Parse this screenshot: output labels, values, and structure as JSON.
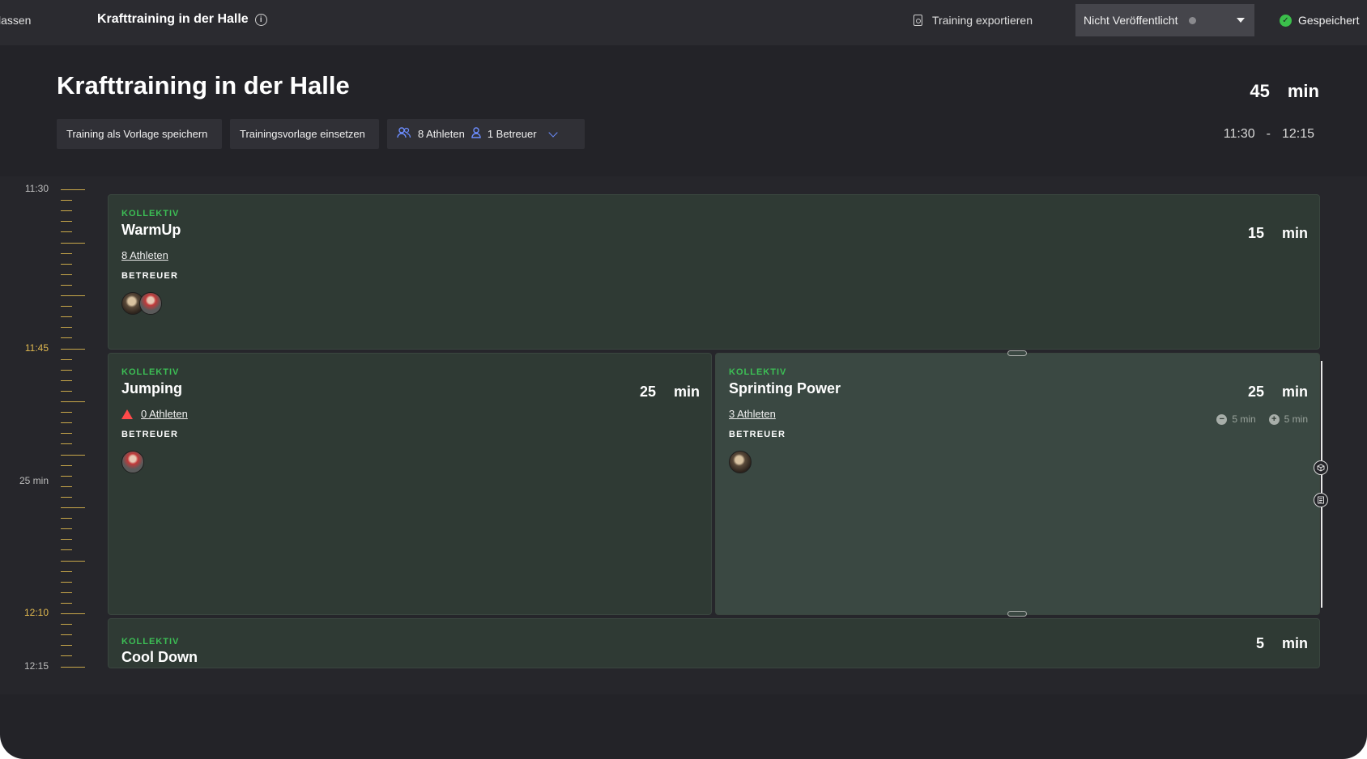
{
  "topbar": {
    "back_label": "lassen",
    "title": "Krafttraining in der Halle",
    "export_label": "Training exportieren",
    "publish_status": "Nicht Veröffentlicht",
    "saved_label": "Gespeichert"
  },
  "header": {
    "title": "Krafttraining in der Halle",
    "save_template_label": "Training als Vorlage speichern",
    "use_template_label": "Trainingsvorlage einsetzen",
    "athletes_label": "8 Athleten",
    "coaches_label": "1 Betreuer",
    "duration_value": "45",
    "duration_unit": "min",
    "start_time": "11:30",
    "time_separator": "-",
    "end_time": "12:15"
  },
  "ruler": {
    "labels": [
      "11:30",
      "11:45",
      "25 min",
      "12:10",
      "12:15"
    ]
  },
  "blocks": [
    {
      "tag": "KOLLEKTIV",
      "name": "WarmUp",
      "athletes": "8 Athleten",
      "coaches_heading": "BETREUER",
      "duration_value": "15",
      "duration_unit": "min"
    },
    {
      "tag": "KOLLEKTIV",
      "name": "Jumping",
      "athletes": "0 Athleten",
      "coaches_heading": "BETREUER",
      "duration_value": "25",
      "duration_unit": "min"
    },
    {
      "tag": "KOLLEKTIV",
      "name": "Sprinting Power",
      "athletes": "3 Athleten",
      "coaches_heading": "BETREUER",
      "duration_value": "25",
      "duration_unit": "min",
      "decrease_label": "5 min",
      "increase_label": "5 min"
    },
    {
      "tag": "KOLLEKTIV",
      "name": "Cool Down",
      "duration_value": "5",
      "duration_unit": "min"
    }
  ],
  "colors": {
    "background": "#232328",
    "block": "#2f3a34",
    "accent_green": "#3cbf55",
    "accent_blue": "#6c8dff",
    "ruler_gold": "#c9a84a",
    "warning_red": "#ff4a4a"
  }
}
